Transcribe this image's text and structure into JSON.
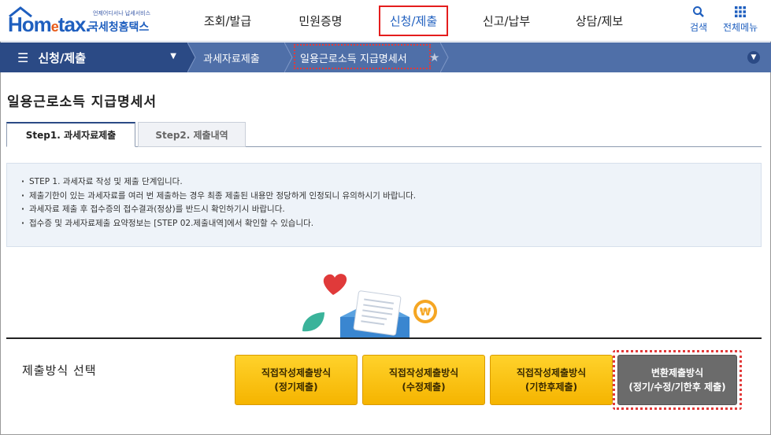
{
  "logo": {
    "tagline": "언제어디서나 납세서비스",
    "brand_home": "Hom",
    "brand_e": "e",
    "brand_tax": "tax.",
    "brand_kr": "국세청홈택스"
  },
  "gnb": {
    "items": [
      {
        "label": "조회/발급"
      },
      {
        "label": "민원증명"
      },
      {
        "label": "신청/제출"
      },
      {
        "label": "신고/납부"
      },
      {
        "label": "상담/제보"
      }
    ]
  },
  "util": {
    "search": "검색",
    "menu": "전체메뉴"
  },
  "subbar": {
    "menu_label": "신청/제출",
    "crumbs": [
      "과세자료제출",
      "일용근로소득 지급명세서"
    ]
  },
  "page": {
    "title": "일용근로소득 지급명세서"
  },
  "tabs": [
    {
      "label": "Step1. 과세자료제출"
    },
    {
      "label": "Step2. 제출내역"
    }
  ],
  "notice": {
    "items": [
      "STEP 1. 과세자료 작성 및 제출 단계입니다.",
      "제출기한이 있는 과세자료를 여러 번 제출하는 경우 최종 제출된 내용만 정당하게 인정되니 유의하시기 바랍니다.",
      "과세자료 제출 후 접수증의 접수결과(정상)를 반드시 확인하기시 바랍니다.",
      "접수증 및 과세자료제출 요약정보는 [STEP 02.제출내역]에서 확인할 수 있습니다."
    ]
  },
  "method": {
    "label": "제출방식 선택",
    "buttons": [
      {
        "label": "직접작성제출방식\n(정기제출)"
      },
      {
        "label": "직접작성제출방식\n(수정제출)"
      },
      {
        "label": "직접작성제출방식\n(기한후제출)"
      },
      {
        "label": "변환제출방식\n(정기/수정/기한후 제출)"
      }
    ]
  },
  "colors": {
    "primary": "#1f5fbf",
    "nav_dark": "#2b4a85",
    "nav_mid": "#4f6fa8",
    "button_yellow": "#ffcc1a",
    "button_gray": "#6b6b6b",
    "highlight_red": "#e23a3a"
  }
}
